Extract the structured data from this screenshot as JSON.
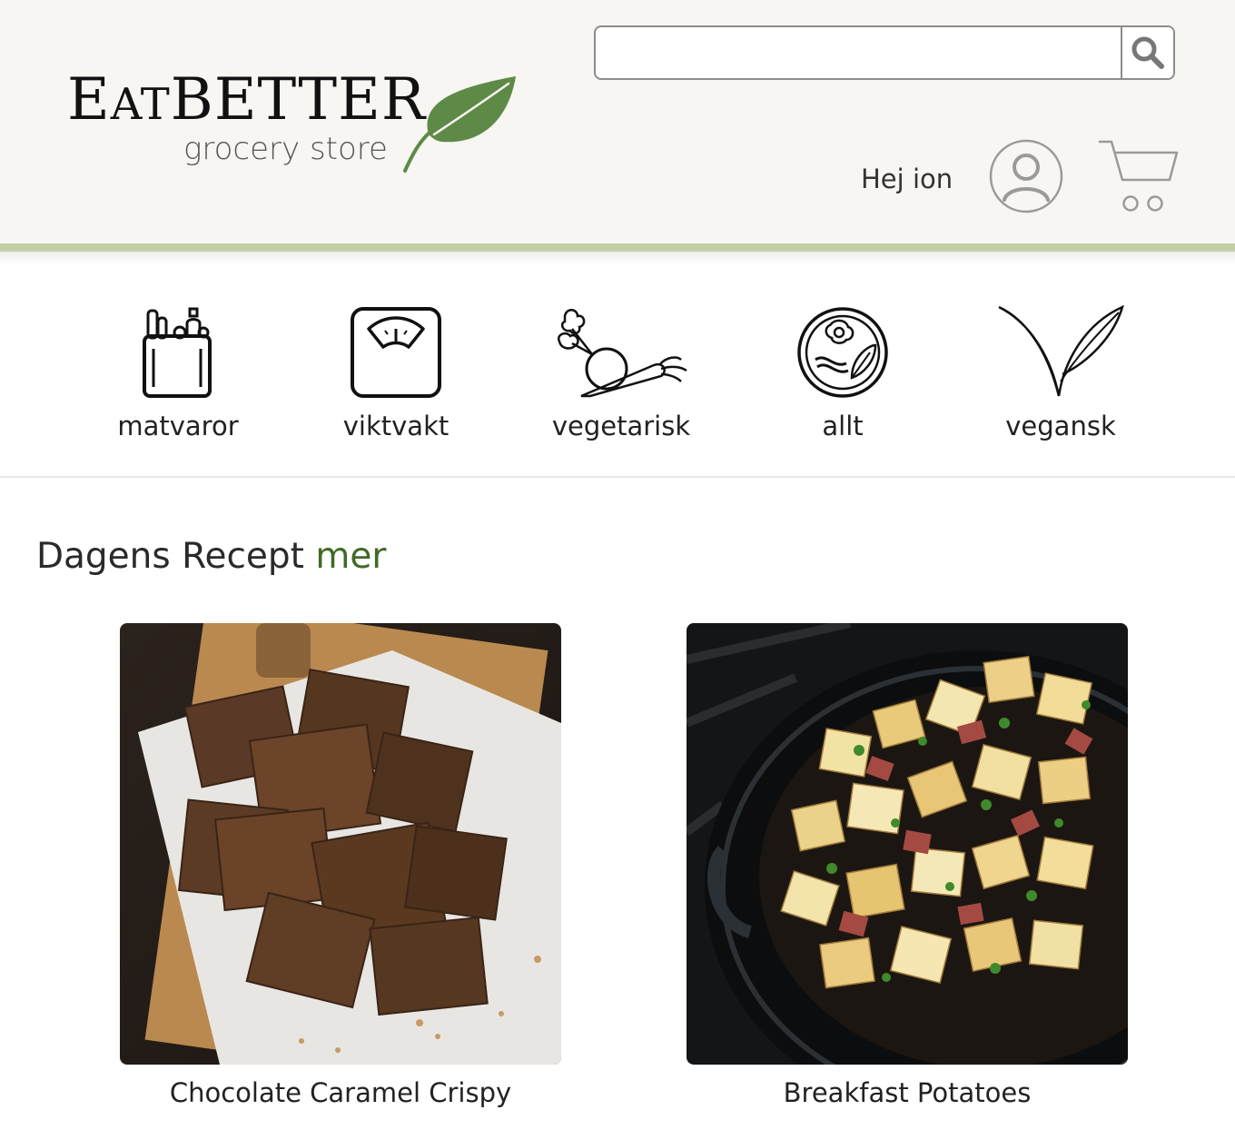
{
  "header": {
    "logo": {
      "word_part1": "E",
      "word_part1_sc": "AT",
      "word_part2": "BETTER",
      "subtitle": "grocery store"
    },
    "search": {
      "value": "",
      "placeholder": ""
    },
    "greeting_prefix": "Hej",
    "greeting_name": "ion",
    "icons": {
      "search": "search-icon",
      "user": "user-icon",
      "cart": "cart-icon",
      "leaf": "leaf-icon"
    }
  },
  "categories": [
    {
      "label": "matvaror",
      "icon": "grocery-bag-icon"
    },
    {
      "label": "viktvakt",
      "icon": "scale-icon"
    },
    {
      "label": "vegetarisk",
      "icon": "vegetables-icon"
    },
    {
      "label": "allt",
      "icon": "plate-icon"
    },
    {
      "label": "vegansk",
      "icon": "sprout-icon"
    }
  ],
  "section": {
    "title": "Dagens Recept",
    "more": "mer"
  },
  "recipes": [
    {
      "name": "Chocolate Caramel Crispy"
    },
    {
      "name": "Breakfast Potatoes"
    }
  ],
  "colors": {
    "header_bg": "#f7f6f2",
    "header_stripe": "#c2d0a8",
    "accent_green": "#3f6b25",
    "leaf_green": "#5e8a48"
  }
}
